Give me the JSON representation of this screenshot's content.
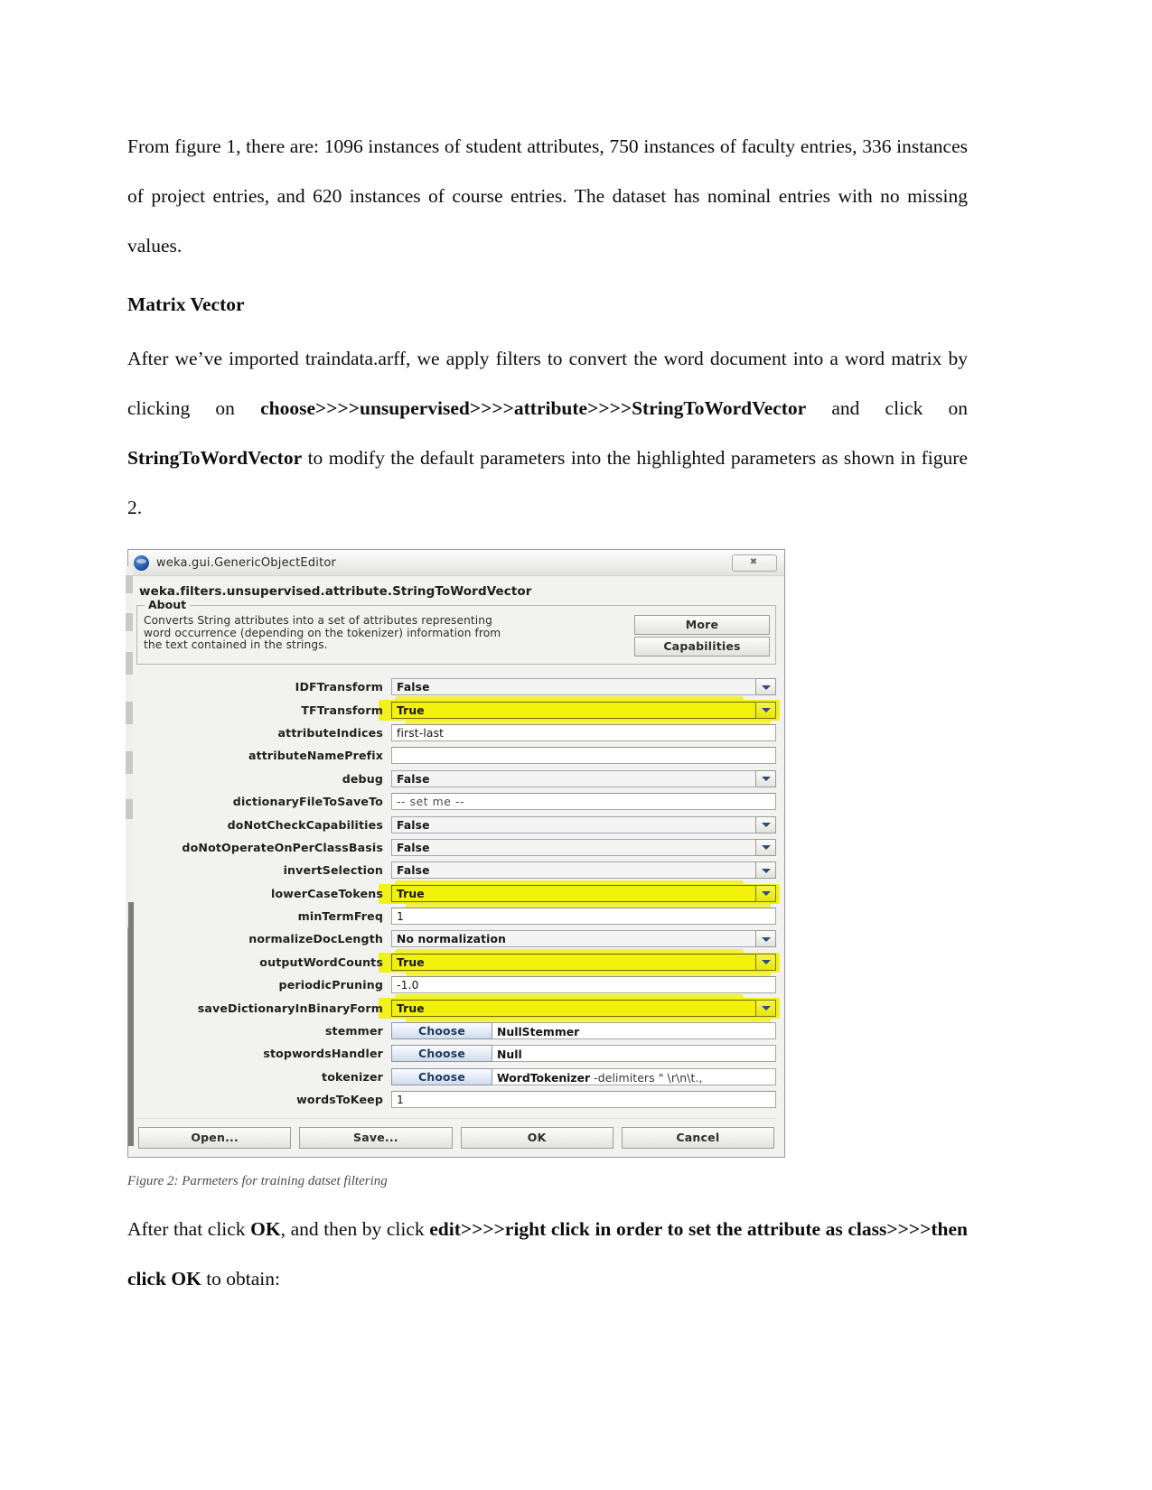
{
  "document": {
    "paragraph1": "From figure 1, there are: 1096 instances of student attributes, 750 instances of faculty entries, 336 instances of project entries, and 620 instances of course entries. The dataset has nominal entries with no missing values.",
    "heading": "Matrix Vector",
    "paragraph2_part1": "After we’ve imported traindata.arff, we apply filters to convert the word document into a  word matrix by clicking on ",
    "paragraph2_bold1": "choose>>>>unsupervised>>>>attribute>>>>StringToWordVector",
    "paragraph2_part2": " and click on ",
    "paragraph2_bold2": "StringToWordVector",
    "paragraph2_part3": " to modify the default parameters into the highlighted parameters as shown in figure 2.",
    "figure_caption": "Figure 2: Parmeters for training datset filtering",
    "paragraph3_part1": "After that click ",
    "paragraph3_bold1": "OK",
    "paragraph3_part2": ", and then by click ",
    "paragraph3_bold2": "edit>>>>right click in order to set the attribute as class>>>>then click OK",
    "paragraph3_part3": " to obtain:"
  },
  "weka_dialog": {
    "window_title": "weka.gui.GenericObjectEditor",
    "close_label": "✖",
    "class_name": "weka.filters.unsupervised.attribute.StringToWordVector",
    "about": {
      "legend": "About",
      "line1": "Converts String attributes into a set of attributes representing",
      "line2": "word occurrence (depending on the tokenizer) information from",
      "line3": "the text contained in the strings.",
      "more_button": "More",
      "capabilities_button": "Capabilities"
    },
    "parameters": [
      {
        "label": "IDFTransform",
        "type": "combo",
        "value": "False",
        "highlighted": false
      },
      {
        "label": "TFTransform",
        "type": "combo",
        "value": "True",
        "highlighted": true
      },
      {
        "label": "attributeIndices",
        "type": "text",
        "value": "first-last",
        "highlighted": false
      },
      {
        "label": "attributeNamePrefix",
        "type": "text",
        "value": "",
        "highlighted": false
      },
      {
        "label": "debug",
        "type": "combo",
        "value": "False",
        "highlighted": false
      },
      {
        "label": "dictionaryFileToSaveTo",
        "type": "text",
        "value": "-- set me --",
        "highlighted": false,
        "muted": true
      },
      {
        "label": "doNotCheckCapabilities",
        "type": "combo",
        "value": "False",
        "highlighted": false
      },
      {
        "label": "doNotOperateOnPerClassBasis",
        "type": "combo",
        "value": "False",
        "highlighted": false
      },
      {
        "label": "invertSelection",
        "type": "combo",
        "value": "False",
        "highlighted": false
      },
      {
        "label": "lowerCaseTokens",
        "type": "combo",
        "value": "True",
        "highlighted": true
      },
      {
        "label": "minTermFreq",
        "type": "text",
        "value": "1",
        "highlighted": false
      },
      {
        "label": "normalizeDocLength",
        "type": "combo",
        "value": "No normalization",
        "highlighted": false
      },
      {
        "label": "outputWordCounts",
        "type": "combo",
        "value": "True",
        "highlighted": true
      },
      {
        "label": "periodicPruning",
        "type": "text",
        "value": "-1.0",
        "highlighted": false
      },
      {
        "label": "saveDictionaryInBinaryForm",
        "type": "combo",
        "value": "True",
        "highlighted": true
      },
      {
        "label": "stemmer",
        "type": "choose",
        "button": "Choose",
        "value": "NullStemmer",
        "args": "",
        "highlighted": false
      },
      {
        "label": "stopwordsHandler",
        "type": "choose",
        "button": "Choose",
        "value": "Null",
        "args": "",
        "highlighted": false
      },
      {
        "label": "tokenizer",
        "type": "choose",
        "button": "Choose",
        "value": "WordTokenizer",
        "args": " -delimiters \" \\r\\n\\t.,",
        "highlighted": false
      },
      {
        "label": "wordsToKeep",
        "type": "text",
        "value": "1",
        "highlighted": false
      }
    ],
    "buttons": {
      "open": "Open...",
      "save": "Save...",
      "ok": "OK",
      "cancel": "Cancel"
    },
    "colors": {
      "highlight": "#f2f10a",
      "dialog_bg": "#f2f2f0",
      "choose_button": "#1d3a63"
    }
  }
}
